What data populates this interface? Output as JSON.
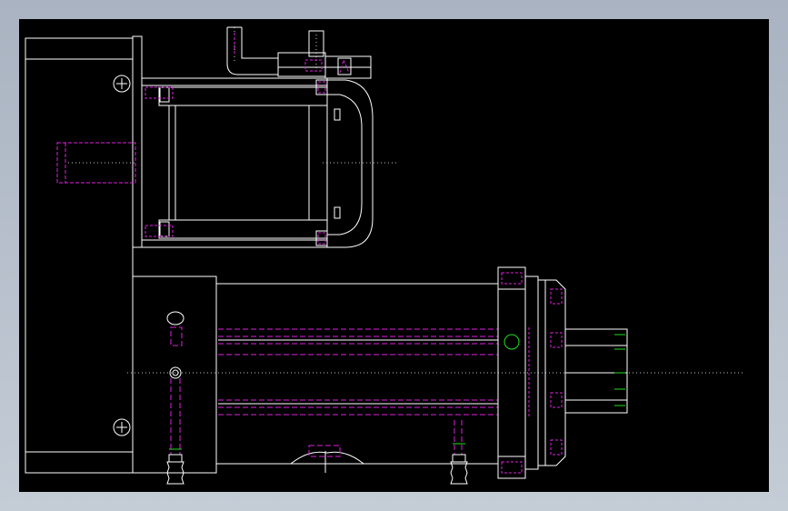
{
  "viewport": {
    "background_top": "#a9b3c1",
    "background_bottom": "#c4ccd6",
    "canvas_color": "#000000"
  },
  "drawing": {
    "subject": "cad-assembly-side-view-motor-and-cylinder",
    "line_colors": {
      "visible_edge": "#ffffff",
      "hidden_edge": "#e020e0",
      "centerline": "#ffffff",
      "highlight": "#20e020"
    },
    "components": [
      "mounting-plate",
      "stepper-motor",
      "motor-cable-connector",
      "pneumatic-cylinder",
      "cylinder-flange",
      "piston-rods",
      "air-fittings",
      "mounting-screws"
    ]
  }
}
